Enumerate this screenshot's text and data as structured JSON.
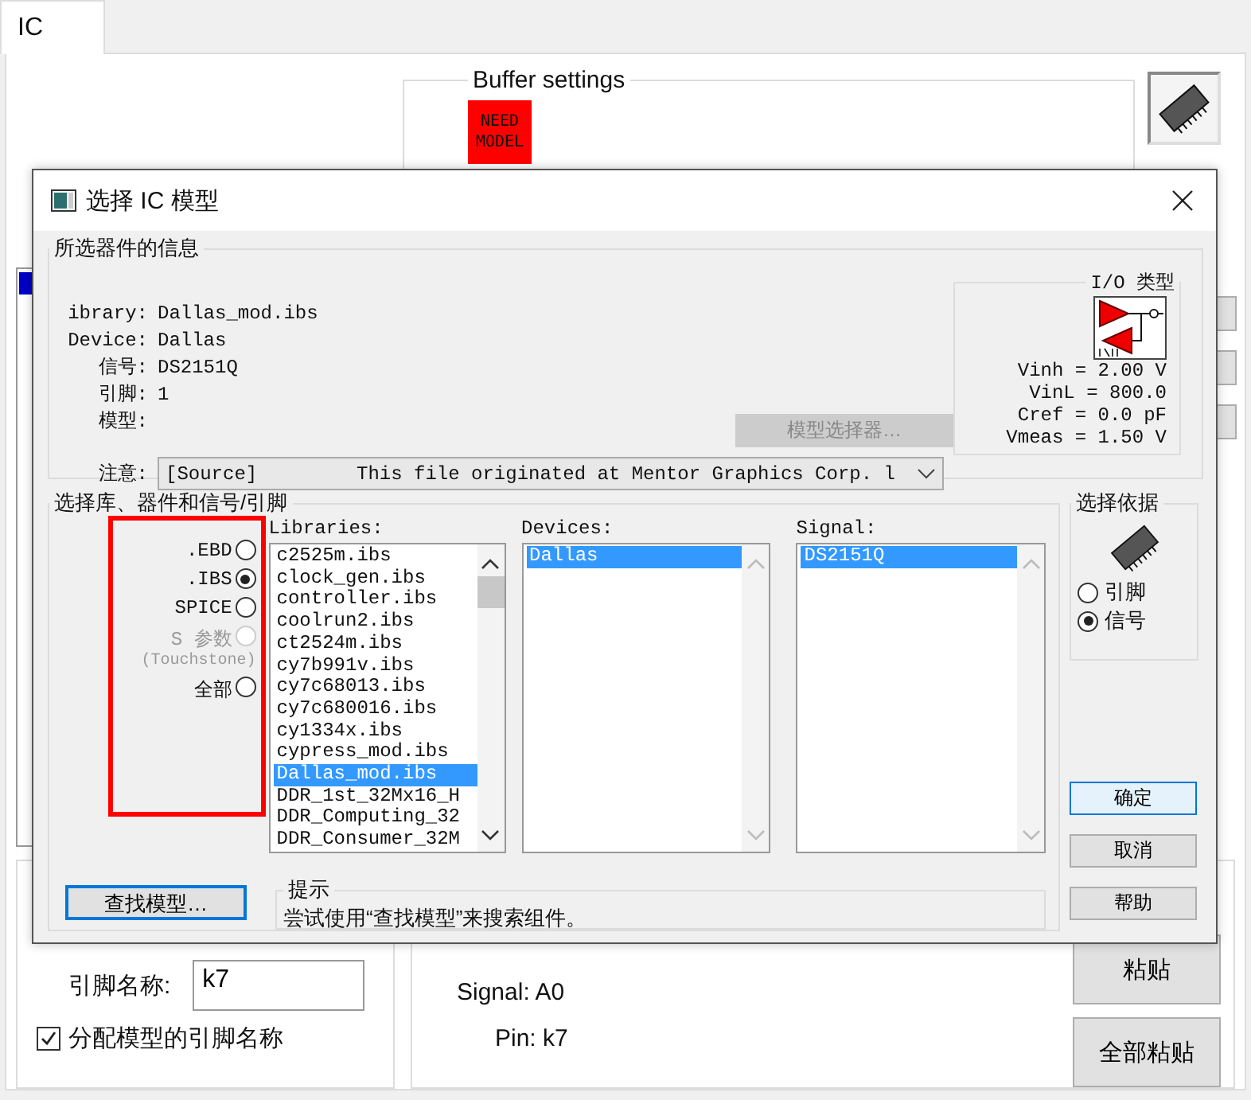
{
  "background": {
    "tabs": [
      {
        "label": "IC",
        "selected": true
      }
    ],
    "buffer_settings": {
      "title": "Buffer settings",
      "badge": "NEED MODEL"
    },
    "pin_name": {
      "label": "引脚名称:",
      "value": "k7"
    },
    "assign_pin_names": {
      "label": "分配模型的引脚名称",
      "checked": true
    },
    "details": [
      "Signal: A0",
      "Pin: k7"
    ],
    "buttons": [
      "粘贴",
      "全部粘贴"
    ]
  },
  "dialog": {
    "title": "选择 IC 模型",
    "info_group": {
      "title": "所选器件的信息",
      "fields": [
        {
          "label": "ibrary:",
          "value": "Dallas_mod.ibs"
        },
        {
          "label": "Device:",
          "value": "Dallas"
        },
        {
          "label": "信号:",
          "value": "DS2151Q"
        },
        {
          "label": "引脚:",
          "value": "1"
        },
        {
          "label": "模型:"
        }
      ],
      "model_selector_button": {
        "label": "模型选择器…",
        "disabled": true
      },
      "note": {
        "label": "注意:",
        "source": "[Source]",
        "value": "This file originated at Mentor Graphics Corp. l"
      },
      "io_type": {
        "title": "I/O 类型",
        "readings": [
          "Vinh = 2.00 V",
          "VinL = 800.0",
          "Cref = 0.0 pF",
          "Vmeas = 1.50 V"
        ]
      }
    },
    "filter_group": {
      "title": "选择库、器件和信号/引脚",
      "file_types": [
        {
          "label": ".EBD",
          "selected": false,
          "disabled": false
        },
        {
          "label": ".IBS",
          "selected": true,
          "disabled": false
        },
        {
          "label": "SPICE",
          "selected": false,
          "disabled": false
        },
        {
          "label": "S 参数",
          "sublabel": "(Touchstone)",
          "selected": false,
          "disabled": true
        },
        {
          "label": "全部",
          "selected": false,
          "disabled": false
        }
      ],
      "lists": [
        {
          "title": "Libraries:",
          "scrollable": true,
          "items": [
            {
              "label": "c2525m.ibs",
              "selected": false
            },
            {
              "label": "clock_gen.ibs",
              "selected": false
            },
            {
              "label": "controller.ibs",
              "selected": false
            },
            {
              "label": "coolrun2.ibs",
              "selected": false
            },
            {
              "label": "ct2524m.ibs",
              "selected": false
            },
            {
              "label": "cy7b991v.ibs",
              "selected": false
            },
            {
              "label": "cy7c68013.ibs",
              "selected": false
            },
            {
              "label": "cy7c680016.ibs",
              "selected": false
            },
            {
              "label": "cy1334x.ibs",
              "selected": false
            },
            {
              "label": "cypress_mod.ibs",
              "selected": false
            },
            {
              "label": "Dallas_mod.ibs",
              "selected": true
            },
            {
              "label": "DDR_1st_32Mx16_H",
              "selected": false
            },
            {
              "label": "DDR_Computing_32",
              "selected": false
            },
            {
              "label": "DDR_Consumer_32M",
              "selected": false
            }
          ]
        },
        {
          "title": "Devices:",
          "scrollable": false,
          "items": [
            {
              "label": "Dallas",
              "selected": true
            }
          ]
        },
        {
          "title": "Signal:",
          "scrollable": false,
          "items": [
            {
              "label": "DS2151Q",
              "selected": true
            }
          ]
        }
      ],
      "find_button": {
        "label": "查找模型…",
        "focused": true
      },
      "hint": {
        "title": "提示",
        "text": "尝试使用“查找模型”来搜索组件。"
      }
    },
    "basis": {
      "title": "选择依据",
      "options": [
        {
          "label": "引脚",
          "selected": false
        },
        {
          "label": "信号",
          "selected": true
        }
      ]
    },
    "buttons": [
      {
        "label": "确定",
        "default": true
      },
      {
        "label": "取消",
        "default": false
      },
      {
        "label": "帮助",
        "default": false
      }
    ]
  }
}
